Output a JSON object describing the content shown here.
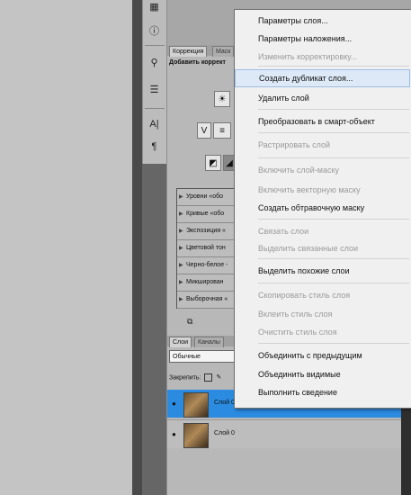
{
  "colors": {
    "highlight": "#2a8be0",
    "menu_bg": "#f0f0f0",
    "disabled": "#9a9a9a"
  },
  "toolbar_icons": [
    "image-icon",
    "info-icon",
    "usb-icon",
    "clipboard-icon",
    "text-icon",
    "paragraph-icon"
  ],
  "adjustments": {
    "tabs": [
      "Коррекция",
      "Маск"
    ],
    "title": "Добавить коррект",
    "presets": [
      "Уровни «обо",
      "Кривые «обо",
      "Экспозиция «",
      "Цветовой тон",
      "Черно-белое -",
      "Микширован",
      "Выборочная «"
    ]
  },
  "layers_panel": {
    "tabs": [
      "Слои",
      "Каналы"
    ],
    "blend_mode": "Обычные",
    "lock_label": "Закрепить:",
    "layers": [
      {
        "name": "Слой 0 копия",
        "selected": true
      },
      {
        "name": "Слой 0",
        "selected": false
      }
    ]
  },
  "context_menu": {
    "items": [
      {
        "label": "Параметры слоя...",
        "disabled": false,
        "highlighted": false,
        "sep_before": false
      },
      {
        "label": "Параметры наложения...",
        "disabled": false,
        "highlighted": false,
        "sep_before": false
      },
      {
        "label": "Изменить корректировку...",
        "disabled": true,
        "highlighted": false,
        "sep_before": false
      },
      {
        "label": "Создать дубликат слоя...",
        "disabled": false,
        "highlighted": true,
        "sep_before": true
      },
      {
        "label": "Удалить слой",
        "disabled": false,
        "highlighted": false,
        "sep_before": false
      },
      {
        "label": "Преобразовать в смарт-объект",
        "disabled": false,
        "highlighted": false,
        "sep_before": true
      },
      {
        "label": "Растрировать слой",
        "disabled": true,
        "highlighted": false,
        "sep_before": true
      },
      {
        "label": "Включить слой-маску",
        "disabled": true,
        "highlighted": false,
        "sep_before": true
      },
      {
        "label": "Включить векторную маску",
        "disabled": true,
        "highlighted": false,
        "sep_before": false
      },
      {
        "label": "Создать обтравочную маску",
        "disabled": false,
        "highlighted": false,
        "sep_before": false
      },
      {
        "label": "Связать слои",
        "disabled": true,
        "highlighted": false,
        "sep_before": true
      },
      {
        "label": "Выделить связанные слои",
        "disabled": true,
        "highlighted": false,
        "sep_before": false
      },
      {
        "label": "Выделить похожие слои",
        "disabled": false,
        "highlighted": false,
        "sep_before": true
      },
      {
        "label": "Скопировать стиль слоя",
        "disabled": true,
        "highlighted": false,
        "sep_before": true
      },
      {
        "label": "Вклеить стиль слоя",
        "disabled": true,
        "highlighted": false,
        "sep_before": false
      },
      {
        "label": "Очистить стиль слоя",
        "disabled": true,
        "highlighted": false,
        "sep_before": false
      },
      {
        "label": "Объединить с предыдущим",
        "disabled": false,
        "highlighted": false,
        "sep_before": true
      },
      {
        "label": "Объединить видимые",
        "disabled": false,
        "highlighted": false,
        "sep_before": false
      },
      {
        "label": "Выполнить сведение",
        "disabled": false,
        "highlighted": false,
        "sep_before": false
      }
    ]
  }
}
